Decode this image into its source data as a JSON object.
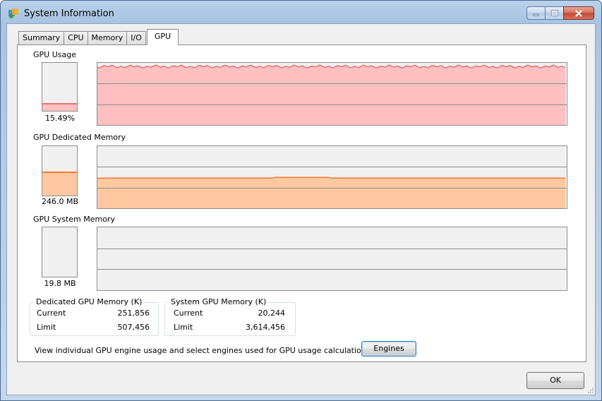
{
  "window": {
    "title": "System Information",
    "icon": "system-info-icon",
    "controls": [
      "minimize-icon",
      "maximize-icon",
      "close-icon"
    ]
  },
  "tabs": [
    {
      "label": "Summary",
      "active": false
    },
    {
      "label": "CPU",
      "active": false
    },
    {
      "label": "Memory",
      "active": false
    },
    {
      "label": "I/O",
      "active": false
    },
    {
      "label": "GPU",
      "active": true
    }
  ],
  "gpu_usage": {
    "label": "GPU Usage",
    "value": "15.49%",
    "level": 0.155,
    "graph_level": 0.94,
    "color": "#ffc0c0",
    "line_color": "#e87070"
  },
  "gpu_dedicated": {
    "label": "GPU Dedicated Memory",
    "value": "246.0 MB",
    "level": 0.485,
    "graph_level": 0.485,
    "color": "#ffc8a0",
    "line_color": "#ff7a30"
  },
  "gpu_system": {
    "label": "GPU System Memory",
    "value": "19.8 MB",
    "level": 0.0,
    "graph_level": 0.0
  },
  "dedicated_group": {
    "title": "Dedicated GPU Memory (K)",
    "rows": [
      {
        "key": "Current",
        "value": "251,856"
      },
      {
        "key": "Limit",
        "value": "507,456"
      }
    ]
  },
  "system_group": {
    "title": "System GPU Memory (K)",
    "rows": [
      {
        "key": "Current",
        "value": "20,244"
      },
      {
        "key": "Limit",
        "value": "3,614,456"
      }
    ]
  },
  "engines": {
    "text": "View individual GPU engine usage and select engines used for GPU usage calculations:",
    "button": "Engines"
  },
  "ok_button": "OK"
}
